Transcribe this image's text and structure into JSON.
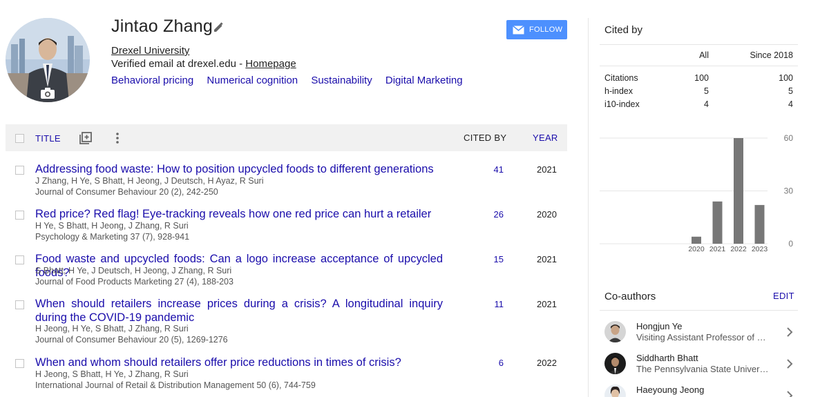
{
  "profile": {
    "name": "Jintao Zhang",
    "affiliation": "Drexel University",
    "email_text": "Verified email at drexel.edu - ",
    "homepage_label": "Homepage",
    "interests": [
      "Behavioral pricing",
      "Numerical cognition",
      "Sustainability",
      "Digital Marketing"
    ],
    "follow_label": "FOLLOW"
  },
  "table": {
    "headers": {
      "title": "TITLE",
      "cited_by": "CITED BY",
      "year": "YEAR"
    },
    "rows": [
      {
        "title": "Addressing food waste: How to position upcycled foods to different generations",
        "authors": "J Zhang, H Ye, S Bhatt, H Jeong, J Deutsch, H Ayaz, R Suri",
        "venue": "Journal of Consumer Behaviour 20 (2), 242-250",
        "cited_by": "41",
        "year": "2021"
      },
      {
        "title": "Red price? Red flag! Eye-tracking reveals how one red price can hurt a retailer",
        "authors": "H Ye, S Bhatt, H Jeong, J Zhang, R Suri",
        "venue": "Psychology & Marketing 37 (7), 928-941",
        "cited_by": "26",
        "year": "2020"
      },
      {
        "title": "Food waste and upcycled foods: Can a logo increase acceptance of upcycled foods?",
        "authors": "S Bhatt, H Ye, J Deutsch, H Jeong, J Zhang, R Suri",
        "venue": "Journal of Food Products Marketing 27 (4), 188-203",
        "cited_by": "15",
        "year": "2021"
      },
      {
        "title": "When should retailers increase prices during a crisis? A longitudinal inquiry during the COVID-19 pandemic",
        "authors": "H Jeong, H Ye, S Bhatt, J Zhang, R Suri",
        "venue": "Journal of Consumer Behaviour 20 (5), 1269-1276",
        "cited_by": "11",
        "year": "2021"
      },
      {
        "title": "When and whom should retailers offer price reductions in times of crisis?",
        "authors": "H Jeong, S Bhatt, H Ye, J Zhang, R Suri",
        "venue": "International Journal of Retail & Distribution Management 50 (6), 744-759",
        "cited_by": "6",
        "year": "2022"
      }
    ]
  },
  "cited_by": {
    "heading": "Cited by",
    "columns": [
      "All",
      "Since 2018"
    ],
    "metrics": [
      {
        "label": "Citations",
        "all": "100",
        "since": "100"
      },
      {
        "label": "h-index",
        "all": "5",
        "since": "5"
      },
      {
        "label": "i10-index",
        "all": "4",
        "since": "4"
      }
    ]
  },
  "chart_data": {
    "type": "bar",
    "categories": [
      "2020",
      "2021",
      "2022",
      "2023"
    ],
    "values": [
      4,
      24,
      60,
      22
    ],
    "title": "",
    "xlabel": "",
    "ylabel": "",
    "ylim": [
      0,
      60
    ],
    "yticks": [
      "60",
      "30",
      "0"
    ],
    "bar_color": "#777777",
    "grid": true
  },
  "coauthors": {
    "heading": "Co-authors",
    "edit_label": "EDIT",
    "list": [
      {
        "name": "Hongjun Ye",
        "affiliation": "Visiting Assistant Professor of M..."
      },
      {
        "name": "Siddharth Bhatt",
        "affiliation": "The Pennsylvania State Universi..."
      },
      {
        "name": "Haeyoung Jeong",
        "affiliation": ""
      }
    ]
  },
  "colors": {
    "link": "#1a0dab",
    "follow_button": "#4d90fe"
  }
}
